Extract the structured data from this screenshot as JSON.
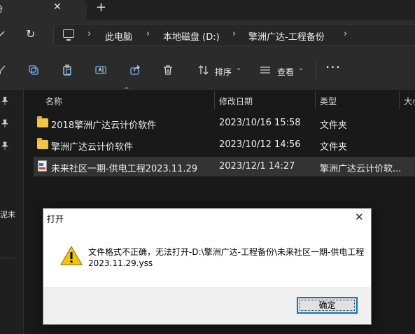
{
  "tab": {
    "title": "备份",
    "close": "✕",
    "new": "+"
  },
  "nav": {
    "up": "ᐩ",
    "refresh": "↻",
    "crumbs": [
      "此电脑",
      "本地磁盘 (D:)",
      "擎洲广达-工程备份"
    ],
    "sep": "›"
  },
  "toolbar": {
    "sort_label": "排序",
    "view_label": "查看",
    "caret": "⌄",
    "more": "···"
  },
  "left": {
    "pin": "📌",
    "text": "泥末"
  },
  "columns": {
    "name": "名称",
    "date": "修改日期",
    "type": "类型",
    "size": "大小",
    "sort_indicator": "^"
  },
  "files": [
    {
      "name": "2018擎洲广达云计价软件",
      "date": "2023/10/16 15:58",
      "type": "文件夹",
      "kind": "folder"
    },
    {
      "name": "擎洲广达云计价软件",
      "date": "2023/10/12 14:56",
      "type": "文件夹",
      "kind": "folder"
    },
    {
      "name": "未来社区一期-供电工程2023.11.29",
      "date": "2023/12/1 14:27",
      "type": "擎洲广达云计价软...",
      "kind": "file"
    }
  ],
  "dialog": {
    "title": "打开",
    "close": "✕",
    "message_line1": "文件格式不正确，无法打开-D:\\擎洲广达-工程备份\\未来社区一期-供电工程",
    "message_line2": "2023.11.29.yss",
    "ok_label": "确定"
  },
  "colors": {
    "accent": "#0078d4",
    "folder": "#f4c542",
    "warning": "#f5c400"
  }
}
